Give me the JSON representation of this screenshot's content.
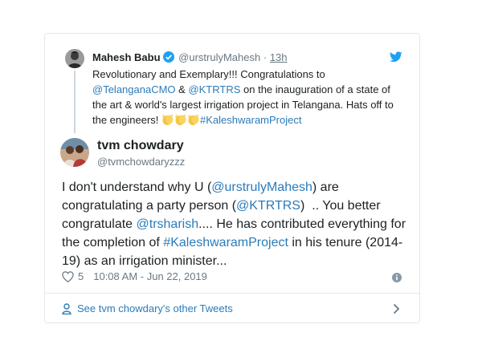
{
  "parent_tweet": {
    "name": "Mahesh Babu",
    "handle": "@urstrulyMahesh",
    "separator": "·",
    "time": "13h",
    "text": {
      "line1": "Revolutionary and Exemplary!!! Congratulations to ",
      "mention1": "@TelanganaCMO",
      "amp": " & ",
      "mention2": "@KTRTRS",
      "line2": " on the inauguration of a state of the art & world's largest irrigation project in Telangana. Hats off to the engineers! ",
      "hashtag": "#KaleshwaramProject"
    },
    "emoji_name": "clapping-hands",
    "emoji_count": 3
  },
  "reply_tweet": {
    "name": "tvm chowdary",
    "handle": "@tvmchowdaryzzz",
    "text": {
      "p1": "I don't understand why U (",
      "m1": "@urstrulyMahesh",
      "p2": ") are congratulating a party person (",
      "m2": "@KTRTRS",
      "p3": ")  .. You better congratulate ",
      "m3": "@trsharish",
      "p4": ".... He has contributed everything for the completion of ",
      "h1": "#KaleshwaramProject",
      "p5": " in his tenure (2014-19) as an irrigation minister..."
    }
  },
  "footer": {
    "likes": "5",
    "timestamp": "10:08 AM - Jun 22, 2019",
    "see_more": "See tvm chowdary's other Tweets"
  },
  "colors": {
    "link": "#2b7bb9",
    "twitter_blue": "#1da1f2",
    "muted": "#697882",
    "border": "#e1e8ed"
  },
  "icons": [
    "twitter-logo",
    "verified-badge",
    "heart-outline",
    "info-circle",
    "person-outline",
    "chevron-right",
    "clapping-hands-emoji"
  ]
}
